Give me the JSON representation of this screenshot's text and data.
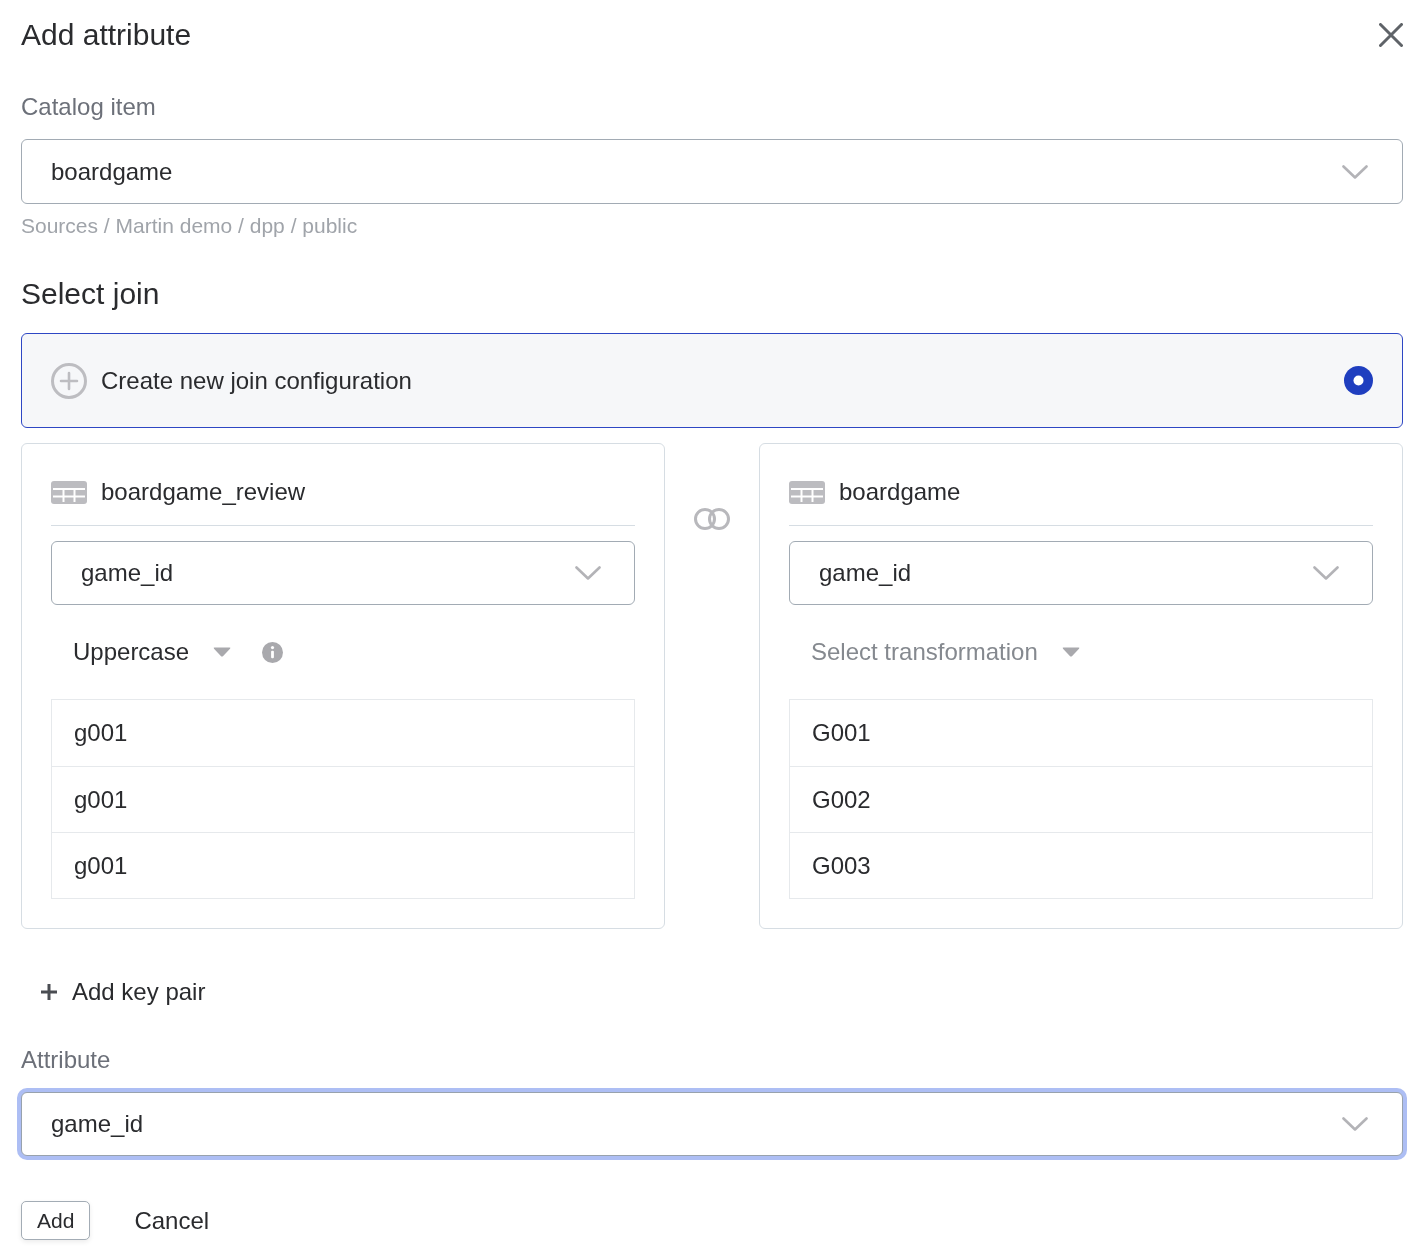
{
  "dialog": {
    "title": "Add attribute"
  },
  "catalog_item": {
    "label": "Catalog item",
    "value": "boardgame",
    "path": "Sources / Martin demo / dpp / public"
  },
  "select_join": {
    "heading": "Select join",
    "options": [
      {
        "label": "Create new join configuration",
        "selected": true
      }
    ]
  },
  "join": {
    "tables": [
      {
        "name": "boardgame_review",
        "key": "game_id",
        "transformation": {
          "value": "Uppercase"
        },
        "values": [
          "g001",
          "g001",
          "g001"
        ]
      },
      {
        "name": "boardgame",
        "key": "game_id",
        "transformation": {
          "placeholder": "Select transformation"
        },
        "values": [
          "G001",
          "G002",
          "G003"
        ]
      }
    ]
  },
  "add_key_pair": {
    "label": "Add key pair"
  },
  "attribute": {
    "label": "Attribute",
    "value": "game_id",
    "focused": true
  },
  "buttons": [
    {
      "label": "Add",
      "kind": "outlined"
    },
    {
      "label": "Cancel",
      "kind": "text"
    }
  ]
}
